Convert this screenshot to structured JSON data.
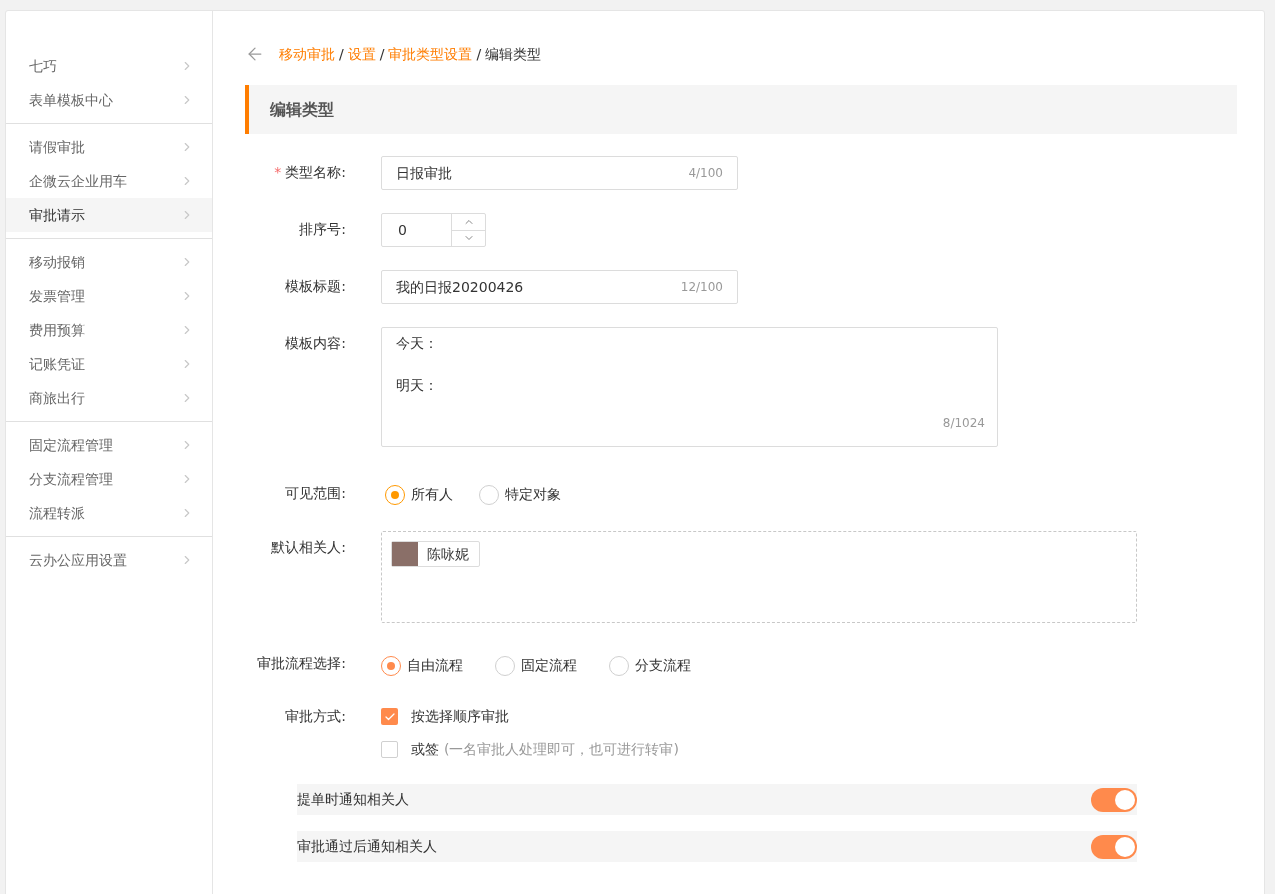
{
  "sidebar": {
    "groups": [
      {
        "items": [
          {
            "label": "七巧",
            "selected": false
          },
          {
            "label": "表单模板中心",
            "selected": false
          }
        ]
      },
      {
        "items": [
          {
            "label": "请假审批",
            "selected": false
          },
          {
            "label": "企微云企业用车",
            "selected": false
          },
          {
            "label": "审批请示",
            "selected": true
          }
        ]
      },
      {
        "items": [
          {
            "label": "移动报销",
            "selected": false
          },
          {
            "label": "发票管理",
            "selected": false
          },
          {
            "label": "费用预算",
            "selected": false
          },
          {
            "label": "记账凭证",
            "selected": false
          },
          {
            "label": "商旅出行",
            "selected": false
          }
        ]
      },
      {
        "items": [
          {
            "label": "固定流程管理",
            "selected": false
          },
          {
            "label": "分支流程管理",
            "selected": false
          },
          {
            "label": "流程转派",
            "selected": false
          }
        ]
      },
      {
        "items": [
          {
            "label": "云办公应用设置",
            "selected": false
          }
        ]
      }
    ]
  },
  "breadcrumb": [
    {
      "label": "移动审批",
      "kind": "link"
    },
    {
      "label": "设置",
      "kind": "link"
    },
    {
      "label": "审批类型设置",
      "kind": "link"
    },
    {
      "label": "编辑类型",
      "kind": "current"
    }
  ],
  "breadcrumb_separator": "/",
  "section_title": "编辑类型",
  "form": {
    "type_name": {
      "label": "类型名称:",
      "required": true,
      "required_mark": "*",
      "value": "日报审批",
      "counter": "4/100"
    },
    "order": {
      "label": "排序号:",
      "value": "0"
    },
    "template_title": {
      "label": "模板标题:",
      "value": "我的日报20200426",
      "counter": "12/100"
    },
    "template_content": {
      "label": "模板内容:",
      "lines": [
        "今天：",
        "明天："
      ],
      "counter": "8/1024"
    },
    "visibility": {
      "label": "可见范围:",
      "options": [
        {
          "label": "所有人",
          "selected": true
        },
        {
          "label": "特定对象",
          "selected": false
        }
      ]
    },
    "default_people": {
      "label": "默认相关人:",
      "people": [
        {
          "name": "陈咏妮"
        }
      ]
    },
    "flow": {
      "label": "审批流程选择:",
      "options": [
        {
          "label": "自由流程",
          "selected": true
        },
        {
          "label": "固定流程",
          "selected": false
        },
        {
          "label": "分支流程",
          "selected": false
        }
      ]
    },
    "method": {
      "label": "审批方式:",
      "options": [
        {
          "label": "按选择顺序审批",
          "checked": true
        },
        {
          "label": "或签",
          "note": "(一名审批人处理即可，也可进行转审)",
          "checked": false
        }
      ]
    },
    "toggles": [
      {
        "label": "提单时通知相关人",
        "on": true
      },
      {
        "label": "审批通过后通知相关人",
        "on": true
      }
    ]
  }
}
